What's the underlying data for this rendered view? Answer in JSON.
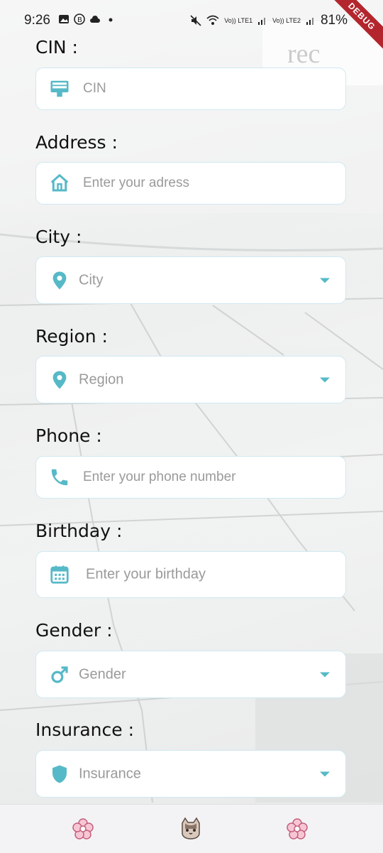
{
  "status_bar": {
    "time": "9:26",
    "battery": "81%",
    "debug_banner": "DEBUG",
    "lte1_label": "Vo)) LTE1",
    "lte2_label": "Vo)) LTE2"
  },
  "form": {
    "cin": {
      "label": "CIN :",
      "placeholder": "CIN",
      "icon": "id-card-icon"
    },
    "address": {
      "label": "Address :",
      "placeholder": "Enter your adress",
      "icon": "home-icon"
    },
    "city": {
      "label": "City :",
      "placeholder": "City",
      "icon": "location-pin-icon"
    },
    "region": {
      "label": "Region :",
      "placeholder": "Region",
      "icon": "location-pin-icon"
    },
    "phone": {
      "label": "Phone :",
      "placeholder": "Enter your phone number",
      "icon": "phone-icon"
    },
    "birthday": {
      "label": "Birthday :",
      "placeholder": "Enter your birthday",
      "icon": "calendar-icon"
    },
    "gender": {
      "label": "Gender :",
      "placeholder": "Gender",
      "icon": "male-icon"
    },
    "insurance": {
      "label": "Insurance :",
      "placeholder": "Insurance",
      "icon": "shield-icon"
    }
  },
  "bottom_nav": {
    "items": [
      "flower-icon",
      "cat-icon",
      "flower-icon"
    ]
  },
  "colors": {
    "accent": "#56b9c7",
    "field_border": "#cfe9f1",
    "debug_banner": "#b3262d"
  }
}
